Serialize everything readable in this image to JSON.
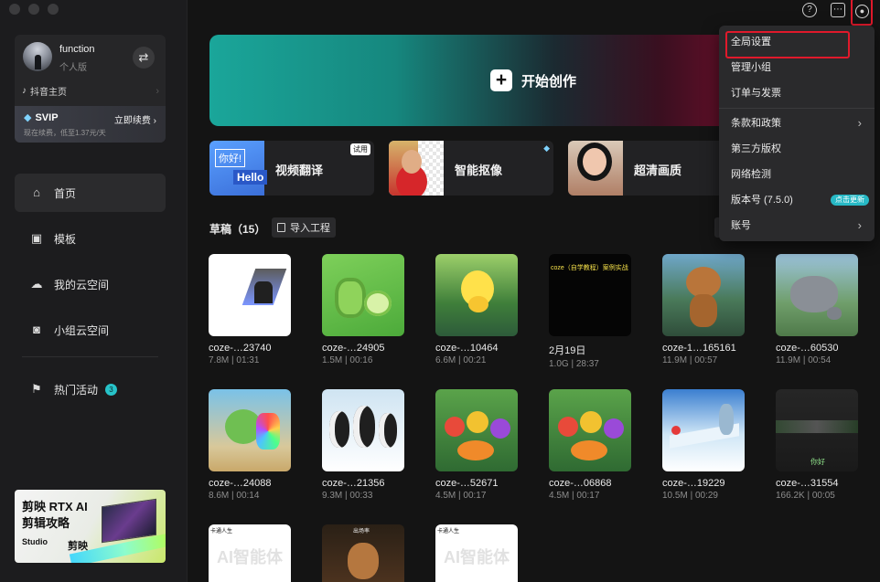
{
  "profile": {
    "name": "function",
    "plan": "个人版",
    "douyin_link": "抖音主页",
    "svip_label": "SVIP",
    "svip_renew": "立即续费",
    "svip_desc": "现在续费，低至1.37元/天"
  },
  "nav": {
    "items": [
      {
        "label": "首页",
        "icon": "home-icon"
      },
      {
        "label": "模板",
        "icon": "template-icon"
      },
      {
        "label": "我的云空间",
        "icon": "cloud-icon"
      },
      {
        "label": "小组云空间",
        "icon": "team-cloud-icon"
      },
      {
        "label": "热门活动",
        "icon": "flag-icon",
        "badge": "3"
      }
    ]
  },
  "promo": {
    "line1": "剪映 RTX AI",
    "line2": "剪辑攻略",
    "studio": "Studio",
    "brand": "剪映"
  },
  "header": {
    "help_icon": "?",
    "message_icon": "message-icon",
    "settings_icon": "gear-icon"
  },
  "create": {
    "label": "开始创作"
  },
  "features": [
    {
      "label": "视频翻译",
      "tag": "试用",
      "thumb_text1": "你好!",
      "thumb_text2": "Hello"
    },
    {
      "label": "智能抠像",
      "tag": "◆"
    },
    {
      "label": "超清画质"
    }
  ],
  "drafts": {
    "title": "草稿（15）",
    "import_label": "导入工程",
    "items": [
      {
        "title": "coze-…23740",
        "meta": "7.8M | 01:31"
      },
      {
        "title": "coze-…24905",
        "meta": "1.5M | 00:16"
      },
      {
        "title": "coze-…10464",
        "meta": "6.6M | 00:21"
      },
      {
        "title": "2月19日",
        "meta": "1.0G | 28:37",
        "overlay": "coze（自学教程）案例实战"
      },
      {
        "title": "coze-1…165161",
        "meta": "11.9M | 00:57"
      },
      {
        "title": "coze-…60530",
        "meta": "11.9M | 00:54"
      },
      {
        "title": "coze-…24088",
        "meta": "8.6M | 00:14"
      },
      {
        "title": "coze-…21356",
        "meta": "9.3M | 00:33"
      },
      {
        "title": "coze-…52671",
        "meta": "4.5M | 00:17"
      },
      {
        "title": "coze-…06868",
        "meta": "4.5M | 00:17"
      },
      {
        "title": "coze-…19229",
        "meta": "10.5M | 00:29"
      },
      {
        "title": "coze-…31554",
        "meta": "166.2K | 00:05",
        "overlay": "你好"
      },
      {
        "title": "",
        "meta": "",
        "overlay": "AI智能体",
        "overlay_small": "卡通人生"
      },
      {
        "title": "",
        "meta": "",
        "overlay_small": "出场率"
      },
      {
        "title": "",
        "meta": "",
        "overlay": "AI智能体",
        "overlay_small": "卡通人生"
      }
    ]
  },
  "menu": {
    "items": [
      {
        "label": "全局设置",
        "highlight": true
      },
      {
        "label": "管理小组"
      },
      {
        "label": "订单与发票"
      },
      {
        "label": "条款和政策",
        "arrow": "›"
      },
      {
        "label": "第三方版权"
      },
      {
        "label": "网络检测"
      },
      {
        "label": "版本号 (7.5.0)",
        "badge": "点击更新"
      },
      {
        "label": "账号",
        "arrow": "›"
      }
    ]
  }
}
